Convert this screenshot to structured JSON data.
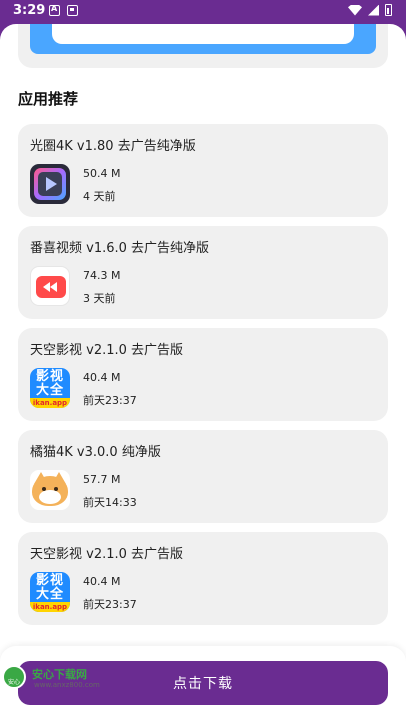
{
  "status_bar": {
    "time": "3:29"
  },
  "section_title": "应用推荐",
  "apps": [
    {
      "title": "光圈4K v1.80 去广告纯净版",
      "size": "50.4 M",
      "time": "4 天前",
      "icon": "guangquan-app-icon"
    },
    {
      "title": "番喜视频 v1.6.0 去广告纯净版",
      "size": "74.3 M",
      "time": "3 天前",
      "icon": "fanxi-app-icon"
    },
    {
      "title": "天空影视 v2.1.0 去广告版",
      "size": "40.4 M",
      "time": "前天23:37",
      "icon": "tiankong-app-icon",
      "icon_text": "影视大全",
      "icon_url_text": "ikan.app"
    },
    {
      "title": "橘猫4K v3.0.0 纯净版",
      "size": "57.7 M",
      "time": "前天14:33",
      "icon": "cat-app-icon"
    },
    {
      "title": "天空影视 v2.1.0 去广告版",
      "size": "40.4 M",
      "time": "前天23:37",
      "icon": "tiankong-app-icon",
      "icon_text": "影视大全",
      "icon_url_text": "ikan.app"
    }
  ],
  "download_button": {
    "label": "点击下载"
  },
  "watermark": {
    "logo_text": "安心",
    "title": "安心下载网",
    "url": "www.anxz800.com"
  },
  "colors": {
    "accent": "#6a2c91",
    "card_bg": "#f0f0f0",
    "banner_blue": "#4aa6ff"
  }
}
